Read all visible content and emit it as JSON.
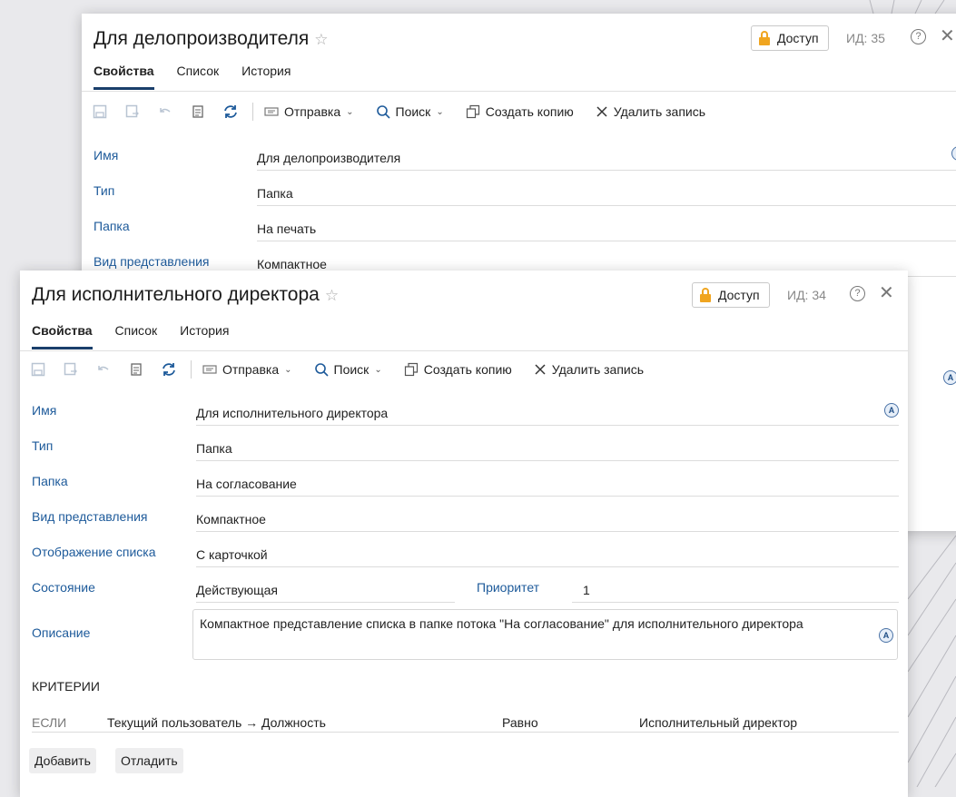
{
  "back_window": {
    "title": "Для делопроизводителя",
    "access_label": "Доступ",
    "id_label": "ИД: 35",
    "tabs": [
      "Свойства",
      "Список",
      "История"
    ],
    "toolbar": {
      "send": "Отправка",
      "search": "Поиск",
      "copy": "Создать копию",
      "delete": "Удалить запись"
    },
    "fields": [
      {
        "label": "Имя",
        "value": "Для делопроизводителя"
      },
      {
        "label": "Тип",
        "value": "Папка"
      },
      {
        "label": "Папка",
        "value": "На печать"
      },
      {
        "label": "Вид представления",
        "value": "Компактное"
      }
    ]
  },
  "front_window": {
    "title": "Для исполнительного директора",
    "access_label": "Доступ",
    "id_label": "ИД: 34",
    "tabs": [
      "Свойства",
      "Список",
      "История"
    ],
    "active_tab": "Свойства",
    "toolbar": {
      "send": "Отправка",
      "search": "Поиск",
      "copy": "Создать копию",
      "delete": "Удалить запись"
    },
    "fields": {
      "name": {
        "label": "Имя",
        "value": "Для исполнительного директора"
      },
      "type": {
        "label": "Тип",
        "value": "Папка"
      },
      "folder": {
        "label": "Папка",
        "value": "На согласование"
      },
      "view": {
        "label": "Вид представления",
        "value": "Компактное"
      },
      "list_display": {
        "label": "Отображение списка",
        "value": "С карточкой"
      },
      "state": {
        "label": "Состояние",
        "value": "Действующая"
      },
      "priority": {
        "label": "Приоритет",
        "value": "1"
      },
      "description": {
        "label": "Описание",
        "value": "Компактное представление списка в папке потока \"На согласование\" для исполнительного директора"
      }
    },
    "criteria": {
      "title": "КРИТЕРИИ",
      "rows": [
        {
          "condition": "ЕСЛИ",
          "field": "Текущий пользователь → Должность",
          "operator": "Равно",
          "value": "Исполнительный директор"
        }
      ]
    },
    "buttons": {
      "add": "Добавить",
      "debug": "Отладить"
    }
  },
  "colors": {
    "accent": "#1a3f6b",
    "label": "#1d5a9a",
    "lock": "#f0a520"
  }
}
